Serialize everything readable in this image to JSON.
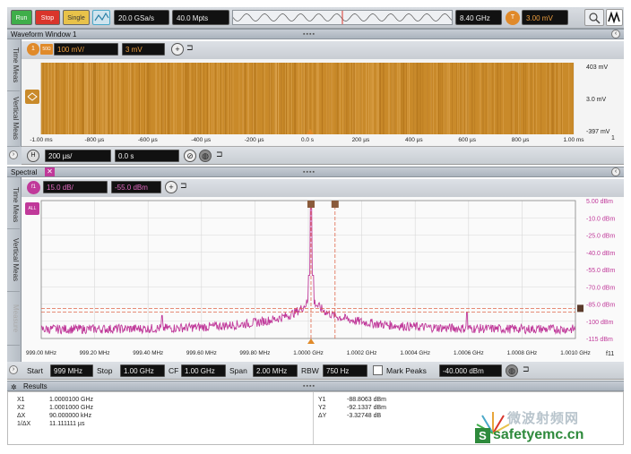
{
  "toolbar": {
    "run_label": "Run",
    "stop_label": "Stop",
    "single_label": "Single",
    "sample_rate": "20.0 GSa/s",
    "memory_depth": "40.0 Mpts",
    "center_freq": "8.40 GHz",
    "trigger_badge": "T",
    "trigger_level": "3.00 mV"
  },
  "waveform": {
    "title": "Waveform Window 1",
    "side_tabs": [
      "Time Meas",
      "Vertical Meas"
    ],
    "channel_badge": "1",
    "channel_sub": "50Ω",
    "vertical_scale": "100 mV/",
    "offset": "3 mV",
    "y_labels": [
      "403 mV",
      "3.0 mV",
      "-397 mV"
    ],
    "x_labels": [
      "-1.00 ms",
      "-800 µs",
      "-600 µs",
      "-400 µs",
      "-200 µs",
      "0.0 s",
      "200 µs",
      "400 µs",
      "600 µs",
      "800 µs",
      "1.00 ms"
    ],
    "page_marker": "1",
    "timebase_badge": "H",
    "time_per_div": "200 µs/",
    "time_position": "0.0 s",
    "trace_color": "#c98a2a"
  },
  "spectral": {
    "title": "Spectral",
    "side_tabs": [
      "Time Meas",
      "Vertical Meas",
      "Measure"
    ],
    "math_badge": "f1",
    "math_side_badge": "ALL",
    "scale": "15.0 dB/",
    "reference": "-55.0 dBm",
    "y_labels": [
      "5.00 dBm",
      "-10.0 dBm",
      "-25.0 dBm",
      "-40.0 dBm",
      "-55.0 dBm",
      "-70.0 dBm",
      "-85.0 dBm",
      "-100 dBm",
      "-115 dBm"
    ],
    "x_labels": [
      "999.00 MHz",
      "999.20 MHz",
      "999.40 MHz",
      "999.60 MHz",
      "999.80 MHz",
      "1.0000 GHz",
      "1.0002 GHz",
      "1.0004 GHz",
      "1.0006 GHz",
      "1.0008 GHz",
      "1.0010 GHz"
    ],
    "page_marker": "f11",
    "trace_color": "#c0399a",
    "marker_color": "#e0664a",
    "start_label": "Start",
    "start_value": "999 MHz",
    "stop_label": "Stop",
    "stop_value": "1.00 GHz",
    "cf_label": "CF",
    "cf_value": "1.00 GHz",
    "span_label": "Span",
    "span_value": "2.00 MHz",
    "rbw_label": "RBW",
    "rbw_value": "750 Hz",
    "mark_peaks_label": "Mark Peaks",
    "mark_peaks_value": "-40.000 dBm"
  },
  "results": {
    "title": "Results",
    "left": [
      {
        "label": "X1",
        "value": "1.0000100 GHz"
      },
      {
        "label": "X2",
        "value": "1.0001000 GHz"
      },
      {
        "label": "ΔX",
        "value": "90.000000 kHz"
      },
      {
        "label": "1/ΔX",
        "value": "11.111111 µs"
      }
    ],
    "right": [
      {
        "label": "Y1",
        "value": "-88.8063 dBm"
      },
      {
        "label": "Y2",
        "value": "-92.1337 dBm"
      },
      {
        "label": "ΔY",
        "value": "-3.32748 dB"
      }
    ]
  },
  "watermark": {
    "cn_text": "微波射频网",
    "url_text": "safetyemc.cn",
    "logo_letter": "S"
  },
  "colors": {
    "run": "#3fae4a",
    "stop": "#d9352b",
    "single": "#e8c24a",
    "trigger": "#e08a2a",
    "accent_cyan": "#4aa8c8"
  }
}
